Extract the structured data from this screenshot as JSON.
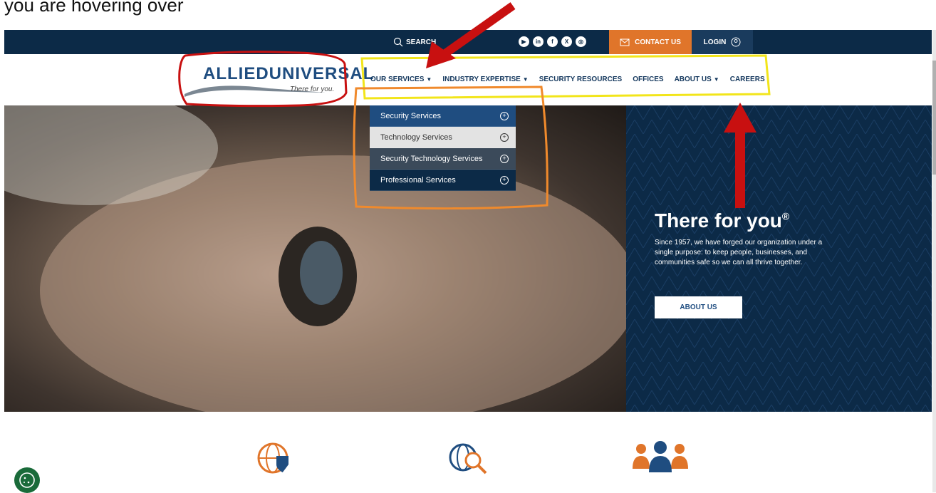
{
  "caption": "you are hovering over",
  "topbar": {
    "search_label": "SEARCH",
    "contact_label": "CONTACT US",
    "login_label": "LOGIN",
    "social_icons": [
      "youtube-icon",
      "linkedin-icon",
      "facebook-icon",
      "x-icon",
      "instagram-icon"
    ]
  },
  "logo": {
    "brand": "ALLIEDUNIVERSAL",
    "tagline": "There for you."
  },
  "nav": {
    "items": [
      {
        "label": "OUR SERVICES",
        "dropdown": true
      },
      {
        "label": "INDUSTRY EXPERTISE",
        "dropdown": true
      },
      {
        "label": "SECURITY RESOURCES",
        "dropdown": false
      },
      {
        "label": "OFFICES",
        "dropdown": false
      },
      {
        "label": "ABOUT US",
        "dropdown": true
      },
      {
        "label": "CAREERS",
        "dropdown": false
      }
    ]
  },
  "dropdown": {
    "items": [
      {
        "label": "Security Services",
        "bg": "#1f4d80",
        "color": "#ffffff"
      },
      {
        "label": "Technology Services",
        "bg": "#e3e3e3",
        "color": "#333333"
      },
      {
        "label": "Security Technology Services",
        "bg": "#3b4a5a",
        "color": "#ffffff"
      },
      {
        "label": "Professional Services",
        "bg": "#0c2a47",
        "color": "#ffffff"
      }
    ]
  },
  "hero": {
    "title": "There for you",
    "title_mark": "®",
    "text": "Since 1957, we have forged our organization under a single purpose: to keep people, businesses, and communities safe so we can all thrive together.",
    "button_label": "ABOUT US"
  },
  "colors": {
    "navy": "#0c2a47",
    "orange": "#e0752a",
    "annotation_red": "#c81010",
    "annotation_yellow": "#f2e51a",
    "annotation_orange": "#f08a2c"
  }
}
